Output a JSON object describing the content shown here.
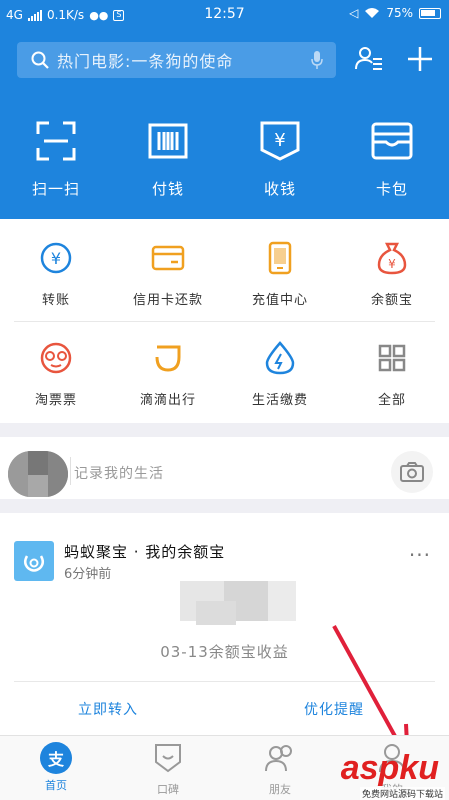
{
  "status": {
    "network": "4G",
    "speed": "0.1K/s",
    "time": "12:57",
    "battery": "75%"
  },
  "search": {
    "placeholder": "热门电影:一条狗的使命"
  },
  "quick_actions": [
    {
      "label": "扫一扫",
      "icon": "scan-icon"
    },
    {
      "label": "付钱",
      "icon": "barcode-icon"
    },
    {
      "label": "收钱",
      "icon": "yuan-receive-icon"
    },
    {
      "label": "卡包",
      "icon": "card-wallet-icon"
    }
  ],
  "grid": [
    {
      "label": "转账",
      "icon": "transfer-icon"
    },
    {
      "label": "信用卡还款",
      "icon": "credit-card-icon"
    },
    {
      "label": "充值中心",
      "icon": "phone-recharge-icon"
    },
    {
      "label": "余额宝",
      "icon": "money-bag-icon"
    },
    {
      "label": "淘票票",
      "icon": "movie-face-icon"
    },
    {
      "label": "滴滴出行",
      "icon": "didi-icon"
    },
    {
      "label": "生活缴费",
      "icon": "water-drop-icon"
    },
    {
      "label": "全部",
      "icon": "grid-all-icon"
    }
  ],
  "post": {
    "placeholder": "记录我的生活"
  },
  "card": {
    "title": "蚂蚁聚宝 · 我的余额宝",
    "time": "6分钟前",
    "caption": "03-13余额宝收益",
    "action_left": "立即转入",
    "action_right": "优化提醒"
  },
  "tabs": [
    {
      "label": "首页",
      "glyph": "支"
    },
    {
      "label": "口碑"
    },
    {
      "label": "朋友"
    },
    {
      "label": "我的"
    }
  ],
  "watermark": {
    "text": "aspku",
    "sub": "免费网站源码下载站"
  },
  "colors": {
    "brand": "#1e84dd",
    "icon_orange": "#f0a020",
    "icon_red": "#e8553e"
  }
}
